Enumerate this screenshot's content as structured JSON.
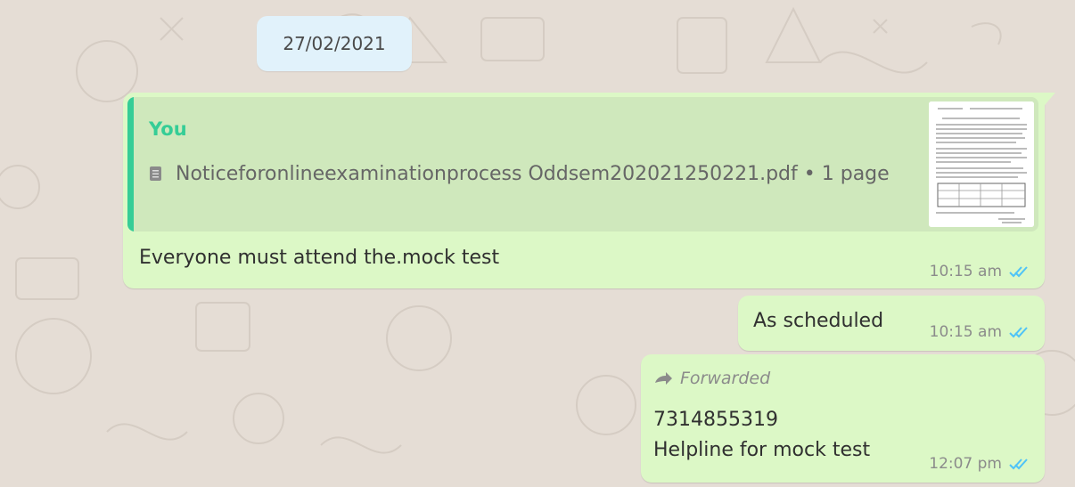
{
  "chat": {
    "date": "27/02/2021",
    "messages": [
      {
        "quote_sender": "You",
        "quote_file": "Noticeforonlineexaminationprocess Oddsem202021250221.pdf",
        "quote_meta": "• 1 page",
        "text": "Everyone must attend the.mock test",
        "time": "10:15 am"
      },
      {
        "text": "As scheduled",
        "time": "10:15 am"
      },
      {
        "forwarded_label": "Forwarded",
        "line1": "7314855319",
        "line2": "Helpline for mock test",
        "time": "12:07 pm"
      }
    ],
    "tick_color": "#4fc3f7"
  }
}
